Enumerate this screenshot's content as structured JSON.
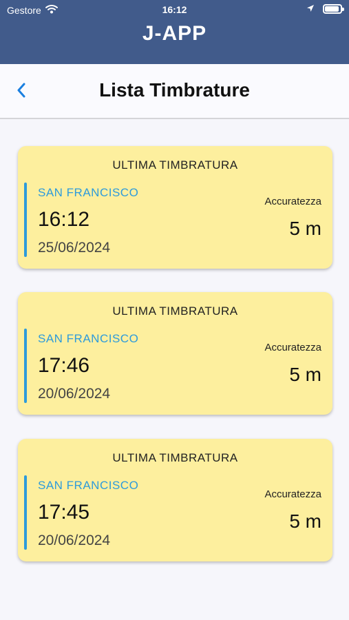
{
  "status_bar": {
    "carrier": "Gestore",
    "time": "16:12",
    "icons": [
      "wifi-icon",
      "location-arrow-icon",
      "battery-icon"
    ]
  },
  "app": {
    "title": "J-APP"
  },
  "nav": {
    "title": "Lista Timbrature",
    "back_icon": "chevron-left-icon"
  },
  "cards": [
    {
      "header": "ULTIMA TIMBRATURA",
      "location": "SAN FRANCISCO",
      "time": "16:12",
      "date": "25/06/2024",
      "accuracy_label": "Accuratezza",
      "accuracy_value": "5 m"
    },
    {
      "header": "ULTIMA TIMBRATURA",
      "location": "SAN FRANCISCO",
      "time": "17:46",
      "date": "20/06/2024",
      "accuracy_label": "Accuratezza",
      "accuracy_value": "5 m"
    },
    {
      "header": "ULTIMA TIMBRATURA",
      "location": "SAN FRANCISCO",
      "time": "17:45",
      "date": "20/06/2024",
      "accuracy_label": "Accuratezza",
      "accuracy_value": "5 m"
    }
  ],
  "colors": {
    "header_bg": "#415b8b",
    "card_bg": "#fdef9e",
    "accent_blue": "#2d9bdb",
    "back_icon": "#1a7fe0"
  }
}
